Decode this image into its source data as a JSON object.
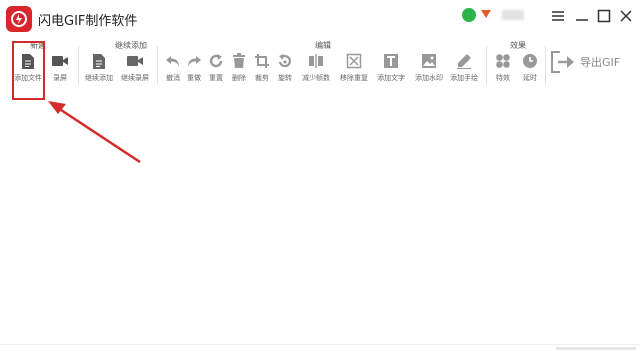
{
  "app": {
    "title": "闪电GIF制作软件",
    "brand_color": "#d9262c"
  },
  "titlebar": {
    "icons": [
      "wechat-icon",
      "vip-icon",
      "menu-icon",
      "minimize-icon",
      "maximize-icon",
      "close-icon"
    ]
  },
  "toolbar": {
    "groups": {
      "new": "新建",
      "continue_add": "继续添加",
      "edit": "编辑",
      "effects": "效果"
    },
    "buttons": {
      "add_file": "添加文件",
      "record": "录屏",
      "continue_add": "继续添加",
      "continue_record": "继续录屏",
      "undo": "撤消",
      "redo": "重做",
      "reset": "重置",
      "delete": "删除",
      "crop": "裁剪",
      "rotate": "旋转",
      "reduce_frames": "减少帧数",
      "remove_duplicates": "移除重复",
      "add_text": "添加文字",
      "add_watermark": "添加水印",
      "add_handwriting": "添加手绘",
      "special_effects": "特效",
      "delay": "延时"
    },
    "export_label": "导出GIF"
  },
  "colors": {
    "annotation_red": "#d42a2a",
    "icon_dark": "#555555",
    "icon_muted": "#9a9a9a"
  }
}
